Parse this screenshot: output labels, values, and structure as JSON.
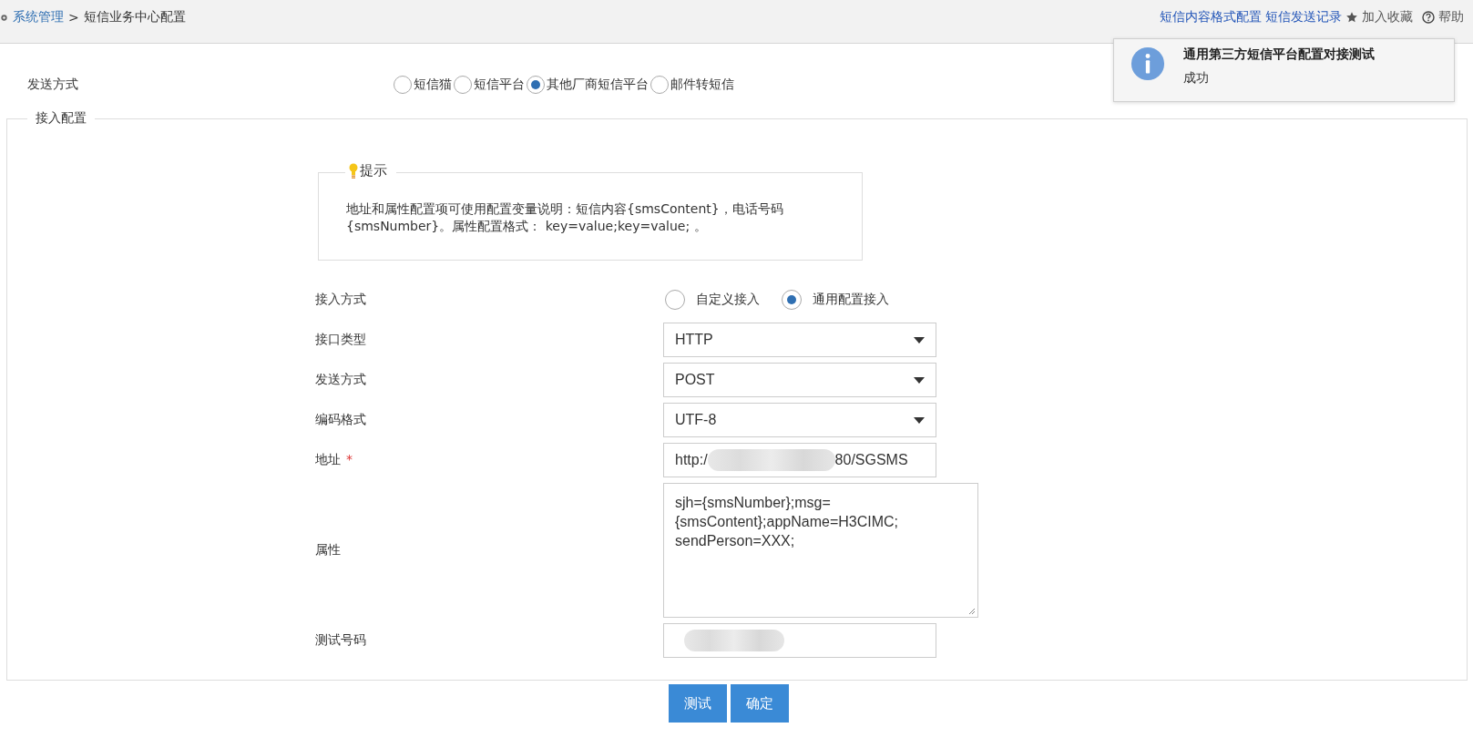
{
  "breadcrumb": {
    "parent": "系统管理",
    "separator": ">",
    "current": "短信业务中心配置"
  },
  "header_links": [
    {
      "kind": "plain",
      "label": "短信内容格式配置"
    },
    {
      "kind": "plain",
      "label": "短信发送记录"
    },
    {
      "kind": "favorite",
      "label": "加入收藏"
    },
    {
      "kind": "help",
      "label": "帮助"
    }
  ],
  "notification": {
    "title": "通用第三方短信平台配置对接测试",
    "message": "成功"
  },
  "send_method": {
    "label": "发送方式",
    "options": [
      {
        "label": "短信猫",
        "selected": false
      },
      {
        "label": "短信平台",
        "selected": false
      },
      {
        "label": "其他厂商短信平台",
        "selected": true
      },
      {
        "label": "邮件转短信",
        "selected": false
      }
    ]
  },
  "access_config": {
    "legend": "接入配置",
    "hint": {
      "title": "提示",
      "text": "地址和属性配置项可使用配置变量说明：短信内容{smsContent}，电话号码{smsNumber}。属性配置格式： key=value;key=value; 。"
    },
    "fields": [
      {
        "kind": "radio",
        "label": "接入方式",
        "options": [
          {
            "label": "自定义接入",
            "selected": false
          },
          {
            "label": "通用配置接入",
            "selected": true
          }
        ]
      },
      {
        "kind": "select",
        "label": "接口类型",
        "value": "HTTP"
      },
      {
        "kind": "select",
        "label": "发送方式",
        "value": "POST"
      },
      {
        "kind": "select",
        "label": "编码格式",
        "value": "UTF-8"
      },
      {
        "kind": "masked",
        "label": "地址",
        "required_mark": "*",
        "value_start": "http:/",
        "value_end": "80/SGSMS"
      },
      {
        "kind": "textarea",
        "label": "属性",
        "value": "sjh={smsNumber};msg=\n{smsContent};appName=H3CIMC;\nsendPerson=XXX;"
      },
      {
        "kind": "hidden_value",
        "label": "测试号码"
      }
    ]
  },
  "buttons": [
    {
      "label": "测试"
    },
    {
      "label": "确定"
    }
  ]
}
